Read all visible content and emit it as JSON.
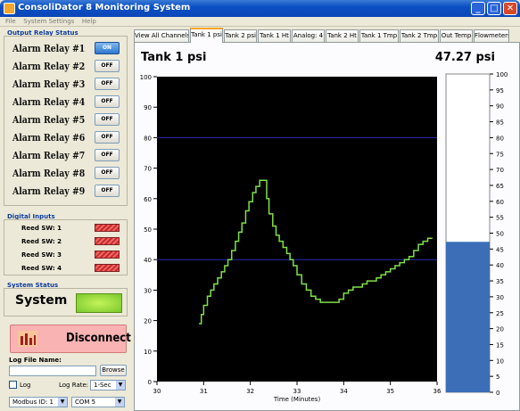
{
  "window": {
    "title": "ConsoliDator 8 Monitoring System",
    "min": "_",
    "max": "□",
    "close": "✕"
  },
  "menu": [
    "File",
    "System Settings",
    "Help"
  ],
  "relays": {
    "title": "Output Relay Status",
    "items": [
      {
        "label": "Alarm Relay #1",
        "state": "ON"
      },
      {
        "label": "Alarm Relay #2",
        "state": "OFF"
      },
      {
        "label": "Alarm Relay #3",
        "state": "OFF"
      },
      {
        "label": "Alarm Relay #4",
        "state": "OFF"
      },
      {
        "label": "Alarm Relay #5",
        "state": "OFF"
      },
      {
        "label": "Alarm Relay #6",
        "state": "OFF"
      },
      {
        "label": "Alarm Relay #7",
        "state": "OFF"
      },
      {
        "label": "Alarm Relay #8",
        "state": "OFF"
      },
      {
        "label": "Alarm Relay #9",
        "state": "OFF"
      }
    ]
  },
  "digital": {
    "title": "Digital Inputs",
    "items": [
      {
        "label": "Reed SW: 1"
      },
      {
        "label": "Reed SW: 2"
      },
      {
        "label": "Reed SW: 3"
      },
      {
        "label": "Reed SW: 4"
      }
    ]
  },
  "status": {
    "title": "System Status",
    "label": "System"
  },
  "disconnect": {
    "label": "Disconnect"
  },
  "log": {
    "file_label": "Log File Name:",
    "file_value": "",
    "browse": "Browse",
    "log_label": "Log",
    "rate_label": "Log Rate:",
    "rate_value": "1-Sec"
  },
  "modbus": {
    "id_value": "Modbus ID: 1",
    "com_value": "COM 5"
  },
  "tabs": [
    "View All Channels",
    "Tank 1 psi",
    "Tank 2 psi",
    "Tank 1 Ht",
    "Analog: 4",
    "Tank 2 Ht",
    "Tank 1 Tmp",
    "Tank 2 Tmp",
    "Out Temp",
    "Flowmeters"
  ],
  "active_tab": 1,
  "chart_header": {
    "title": "Tank 1 psi",
    "value": "47.27 psi"
  },
  "chart_data": {
    "type": "line",
    "title": "Tank 1 psi",
    "xlabel": "Time (Minutes)",
    "ylabel": "",
    "xlim": [
      30,
      36
    ],
    "ylim": [
      0,
      100
    ],
    "x_ticks": [
      "30",
      "31",
      "32",
      "33",
      "34",
      "35",
      "36"
    ],
    "y_ticks": [
      "0",
      "10",
      "20",
      "30",
      "40",
      "50",
      "60",
      "70",
      "80",
      "90",
      "100"
    ],
    "thresholds": [
      80,
      40
    ],
    "series": [
      {
        "color": "#7ee04a",
        "x": [
          30.9,
          30.95,
          31,
          31.08,
          31.15,
          31.22,
          31.3,
          31.38,
          31.45,
          31.52,
          31.6,
          31.68,
          31.75,
          31.82,
          31.9,
          31.97,
          32.05,
          32.12,
          32.2,
          32.28,
          32.35,
          32.4,
          32.48,
          32.55,
          32.62,
          32.7,
          32.78,
          32.85,
          32.92,
          33,
          33.1,
          33.2,
          33.3,
          33.4,
          33.5,
          33.6,
          33.7,
          33.8,
          33.9,
          34,
          34.1,
          34.2,
          34.3,
          34.4,
          34.5,
          34.6,
          34.7,
          34.8,
          34.9,
          35,
          35.1,
          35.2,
          35.3,
          35.4,
          35.5,
          35.6,
          35.7,
          35.8,
          35.9
        ],
        "y": [
          19,
          22,
          25,
          28,
          30,
          32,
          34,
          36,
          38,
          40,
          43,
          46,
          49,
          52,
          56,
          59,
          62,
          64,
          66,
          66,
          60,
          55,
          51,
          48,
          46,
          44,
          42,
          40,
          38,
          35,
          32,
          30,
          28,
          27,
          26,
          26,
          26,
          26,
          27,
          29,
          30,
          31,
          31,
          32,
          33,
          33,
          34,
          35,
          36,
          37,
          38,
          39,
          40,
          41,
          43,
          45,
          46,
          47,
          47
        ]
      }
    ],
    "bar_gauge": {
      "value": 47.27,
      "ylim": [
        0,
        100
      ],
      "y_ticks": [
        "0",
        "5",
        "10",
        "15",
        "20",
        "25",
        "30",
        "35",
        "40",
        "45",
        "50",
        "55",
        "60",
        "65",
        "70",
        "75",
        "80",
        "85",
        "90",
        "95",
        "100"
      ]
    }
  },
  "colors": {
    "plot_bg": "#000000",
    "series": "#7ee04a",
    "threshold": "#2a2ab0",
    "gauge": "#3c6eb8",
    "relay_on": "#2e78d0",
    "digital_indicator": "#c82a2a",
    "system_ok": "#79c82c",
    "disconnect_bg": "#f9b3b3"
  }
}
